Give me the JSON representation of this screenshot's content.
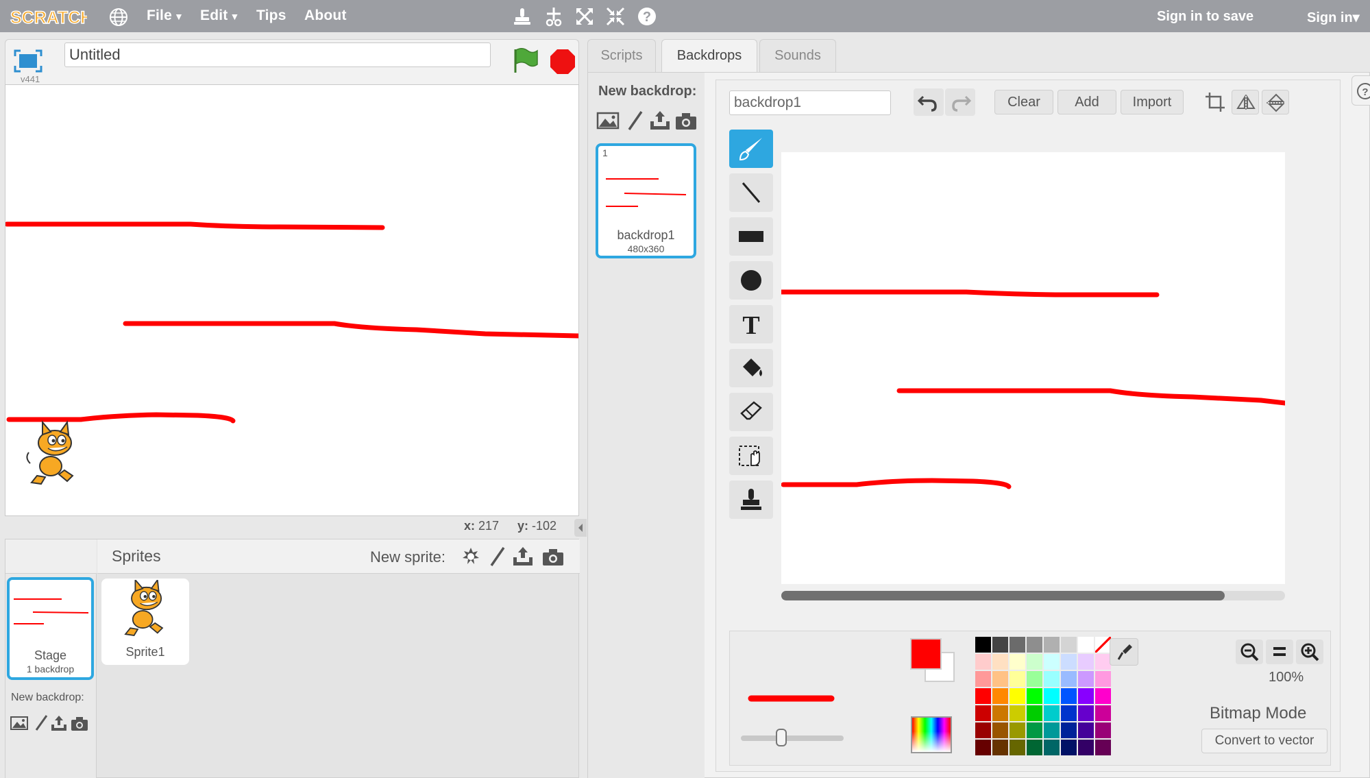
{
  "topbar": {
    "logo_text": "SCRATCH",
    "menus": [
      {
        "label": "File",
        "has_caret": true
      },
      {
        "label": "Edit",
        "has_caret": true
      },
      {
        "label": "Tips",
        "has_caret": false
      },
      {
        "label": "About",
        "has_caret": false
      }
    ],
    "tool_icons": [
      "duplicate-icon",
      "cut-icon",
      "grow-icon",
      "shrink-icon",
      "help-icon"
    ],
    "sign_in_to_save": "Sign in to save",
    "sign_in": "Sign in",
    "sign_in_caret": "▾"
  },
  "stage": {
    "project_title": "Untitled",
    "version": "v441",
    "mouse_x_label": "x:",
    "mouse_x": "217",
    "mouse_y_label": "y:",
    "mouse_y": "-102"
  },
  "sprites": {
    "title": "Sprites",
    "new_sprite_label": "New sprite:",
    "stage_name": "Stage",
    "stage_sub": "1 backdrop",
    "new_backdrop_label": "New backdrop:",
    "items": [
      {
        "name": "Sprite1"
      }
    ]
  },
  "tabs": [
    {
      "label": "Scripts",
      "active": false
    },
    {
      "label": "Backdrops",
      "active": true
    },
    {
      "label": "Sounds",
      "active": false
    }
  ],
  "backdrops": {
    "new_backdrop_label": "New backdrop:",
    "items": [
      {
        "number": "1",
        "name": "backdrop1",
        "size": "480x360",
        "selected": true
      }
    ]
  },
  "paint_editor": {
    "name_value": "backdrop1",
    "clear_label": "Clear",
    "add_label": "Add",
    "import_label": "Import",
    "tools": [
      "brush",
      "line",
      "rectangle",
      "ellipse",
      "text",
      "fill",
      "eraser",
      "select",
      "stamp"
    ],
    "selected_tool": "brush",
    "text_tool_glyph": "T",
    "zoom_level": "100%",
    "mode_label": "Bitmap Mode",
    "convert_label": "Convert to vector",
    "primary_color": "#ff0000",
    "secondary_color": "#ffffff",
    "brush_size_fraction": 0.39,
    "horizontal_scroll_fraction": 0.88,
    "palette": [
      [
        "#000000",
        "#444444",
        "#6b6b6b",
        "#8e8e8e",
        "#b0b0b0",
        "#d4d4d4",
        "#ffffff"
      ],
      [
        "#ffcccc",
        "#ffe0c2",
        "#ffffcc",
        "#ccffcc",
        "#ccffff",
        "#ccddff",
        "#e8ccff",
        "#ffccf0"
      ],
      [
        "#ff9999",
        "#ffc285",
        "#ffff99",
        "#99ff99",
        "#99ffff",
        "#99bbff",
        "#cc99ff",
        "#ff99e0"
      ],
      [
        "#ff0000",
        "#ff8800",
        "#ffff00",
        "#00ff00",
        "#00ffff",
        "#0055ff",
        "#8800ff",
        "#ff00cc"
      ],
      [
        "#cc0000",
        "#cc7700",
        "#cccc00",
        "#00cc00",
        "#00cccc",
        "#0033cc",
        "#6600cc",
        "#cc0099"
      ],
      [
        "#990000",
        "#995500",
        "#999900",
        "#009944",
        "#009999",
        "#002299",
        "#440099",
        "#990077"
      ],
      [
        "#660000",
        "#663300",
        "#666600",
        "#006633",
        "#006666",
        "#001166",
        "#330066",
        "#660055"
      ]
    ]
  },
  "colors": {
    "topbar": "#9c9ea3",
    "accent_blue": "#2ea7e0",
    "stroke_red": "#ff0000"
  }
}
